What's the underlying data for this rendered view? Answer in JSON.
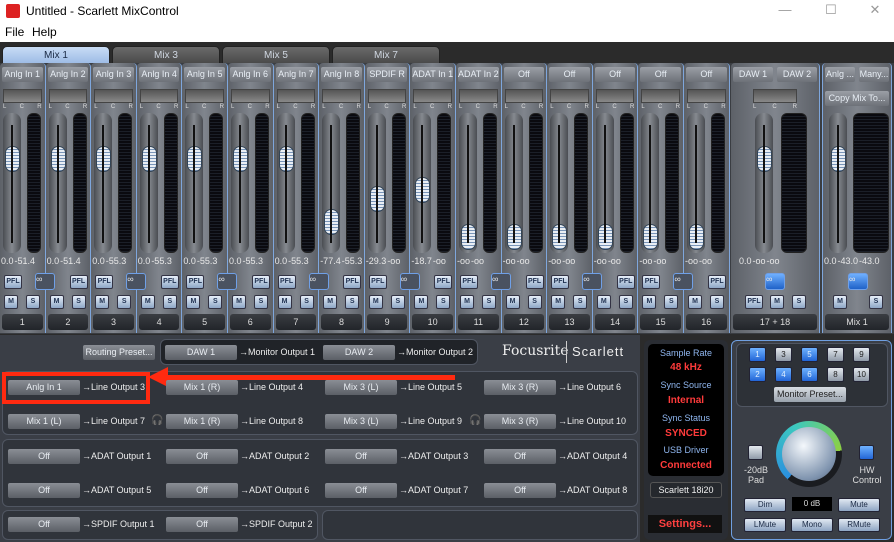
{
  "window": {
    "title": "Untitled - Scarlett MixControl",
    "minimize": "—",
    "maximize": "☐",
    "close": "✕"
  },
  "menu": [
    "File",
    "Help"
  ],
  "tabs": [
    "Mix 1",
    "Mix 3",
    "Mix 5",
    "Mix 7"
  ],
  "channels": [
    {
      "name": "Anlg In 1",
      "fader": "0.0",
      "meter": "-51.4",
      "number": "1",
      "fader_position": 0.78,
      "pfl": "PFL"
    },
    {
      "name": "Anlg In 2",
      "fader": "0.0",
      "meter": "-51.4",
      "number": "2",
      "fader_position": 0.78,
      "pfl": "PFL"
    },
    {
      "name": "Anlg In 3",
      "fader": "0.0",
      "meter": "-55.3",
      "number": "3",
      "fader_position": 0.78,
      "pfl": "PFL"
    },
    {
      "name": "Anlg In 4",
      "fader": "0.0",
      "meter": "-55.3",
      "number": "4",
      "fader_position": 0.78,
      "pfl": "PFL"
    },
    {
      "name": "Anlg In 5",
      "fader": "0.0",
      "meter": "-55.3",
      "number": "5",
      "fader_position": 0.78,
      "pfl": "PFL"
    },
    {
      "name": "Anlg In 6",
      "fader": "0.0",
      "meter": "-55.3",
      "number": "6",
      "fader_position": 0.78,
      "pfl": "PFL"
    },
    {
      "name": "Anlg In 7",
      "fader": "0.0",
      "meter": "-55.3",
      "number": "7",
      "fader_position": 0.78,
      "pfl": "PFL"
    },
    {
      "name": "Anlg In 8",
      "fader": "-77.4",
      "meter": "-55.3",
      "number": "8",
      "fader_position": 0.17,
      "pfl": "PFL"
    },
    {
      "name": "SPDIF R",
      "fader": "-29.3",
      "meter": "-oo",
      "number": "9",
      "fader_position": 0.39,
      "pfl": "PFL"
    },
    {
      "name": "ADAT In 1",
      "fader": "-18.7",
      "meter": "-oo",
      "number": "10",
      "fader_position": 0.48,
      "pfl": "PFL"
    },
    {
      "name": "ADAT In 2",
      "fader": "-oo",
      "meter": "-oo",
      "number": "11",
      "fader_position": 0.03,
      "pfl": "PFL"
    },
    {
      "name": "Off",
      "fader": "-oo",
      "meter": "-oo",
      "number": "12",
      "fader_position": 0.03,
      "pfl": "PFL"
    },
    {
      "name": "Off",
      "fader": "-oo",
      "meter": "-oo",
      "number": "13",
      "fader_position": 0.03,
      "pfl": "PFL"
    },
    {
      "name": "Off",
      "fader": "-oo",
      "meter": "-oo",
      "number": "14",
      "fader_position": 0.03,
      "pfl": "PFL"
    },
    {
      "name": "Off",
      "fader": "-oo",
      "meter": "-oo",
      "number": "15",
      "fader_position": 0.03,
      "pfl": "PFL"
    },
    {
      "name": "Off",
      "fader": "-oo",
      "meter": "-oo",
      "number": "16",
      "fader_position": 0.03,
      "pfl": "PFL"
    }
  ],
  "strip_labels": {
    "mute": "M",
    "solo": "S",
    "link": "∞",
    "l": "L",
    "c": "C",
    "r": "R"
  },
  "daw_strip": {
    "name_l": "DAW 1",
    "name_r": "DAW 2",
    "fader": "0.0",
    "meter_l": "-oo",
    "meter_r": "-oo",
    "number": "17 + 18",
    "fader_position": 0.78,
    "pfl": "PFL"
  },
  "mix_strip": {
    "source": "Anlg ...",
    "many": "Many...",
    "copy": "Copy Mix To...",
    "fader": "0.0",
    "meter_l": "-43.0",
    "meter_r": "-43.0",
    "number": "Mix 1",
    "fader_position": 0.78
  },
  "routing": {
    "preset": "Routing Preset...",
    "logo_a": "Focusrite",
    "logo_b": "Scarlett",
    "monitor": [
      {
        "src": "DAW 1",
        "dst": "→Monitor Output 1"
      },
      {
        "src": "DAW 2",
        "dst": "→Monitor Output 2"
      }
    ],
    "line": [
      {
        "src": "Anlg In 1",
        "dst": "→Line Output 3"
      },
      {
        "src": "Mix 1 (R)",
        "dst": "→Line Output 4"
      },
      {
        "src": "Mix 3 (L)",
        "dst": "→Line Output 5"
      },
      {
        "src": "Mix 3 (R)",
        "dst": "→Line Output 6"
      },
      {
        "src": "Mix 1 (L)",
        "dst": "→Line Output 7"
      },
      {
        "src": "Mix 1 (R)",
        "dst": "→Line Output 8"
      },
      {
        "src": "Mix 3 (L)",
        "dst": "→Line Output 9"
      },
      {
        "src": "Mix 3 (R)",
        "dst": "→Line Output 10"
      }
    ],
    "adat": [
      {
        "src": "Off",
        "dst": "→ADAT Output 1"
      },
      {
        "src": "Off",
        "dst": "→ADAT Output 2"
      },
      {
        "src": "Off",
        "dst": "→ADAT Output 3"
      },
      {
        "src": "Off",
        "dst": "→ADAT Output 4"
      },
      {
        "src": "Off",
        "dst": "→ADAT Output 5"
      },
      {
        "src": "Off",
        "dst": "→ADAT Output 6"
      },
      {
        "src": "Off",
        "dst": "→ADAT Output 7"
      },
      {
        "src": "Off",
        "dst": "→ADAT Output 8"
      }
    ],
    "spdif": [
      {
        "src": "Off",
        "dst": "→SPDIF Output 1"
      },
      {
        "src": "Off",
        "dst": "→SPDIF Output 2"
      }
    ]
  },
  "status": {
    "sample_rate_label": "Sample Rate",
    "sample_rate": "48 kHz",
    "sync_source_label": "Sync Source",
    "sync_source": "Internal",
    "sync_status_label": "Sync Status",
    "sync_status": "SYNCED",
    "usb_label": "USB  Driver",
    "usb": "Connected",
    "device": "Scarlett 18i20",
    "settings": "Settings..."
  },
  "monitor": {
    "outputs": [
      "1",
      "2",
      "3",
      "4",
      "5",
      "6",
      "7",
      "8",
      "9",
      "10"
    ],
    "active": [
      "1",
      "2",
      "4",
      "5",
      "6"
    ],
    "preset": "Monitor Preset...",
    "pad": "-20dB\nPad",
    "hw": "HW\nControl",
    "level": "0 dB",
    "dim": "Dim",
    "mute": "Mute",
    "lmute": "LMute",
    "mono": "Mono",
    "rmute": "RMute",
    "volume_fraction": 0.8
  },
  "colors": {
    "accent": "#6fa0e8",
    "status": "#ff3b3b",
    "annotation": "#ff2a10"
  }
}
